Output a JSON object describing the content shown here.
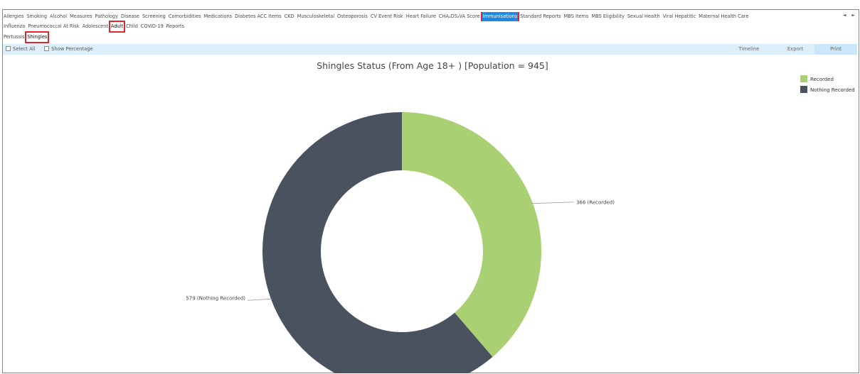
{
  "nav": {
    "main_tabs": [
      "Allergies",
      "Smoking",
      "Alcohol",
      "Measures",
      "Pathology",
      "Disease",
      "Screening",
      "Comorbidities",
      "Medications",
      "Diabetes ACC Items",
      "CKD",
      "Musculoskeletal",
      "Osteoporosis",
      "CV Event Risk",
      "Heart Failure",
      "CHA₂DS₂VA Score",
      "Immunisations",
      "Standard Reports",
      "MBS Items",
      "MBS Eligibility",
      "Sexual Health",
      "Viral Hepatitic",
      "Maternal Health Care"
    ],
    "main_selected": "Immunisations",
    "sub_tabs": [
      "Influenza",
      "Pneumococcal At Risk",
      "Adolescent",
      "Adult",
      "Child",
      "COVID-19",
      "Reports"
    ],
    "sub_selected": "Adult",
    "third_tabs": [
      "Pertussis",
      "Shingles"
    ],
    "third_selected": "Shingles",
    "scroll_arrows": "◄ ►"
  },
  "toolbar": {
    "select_all": "Select All",
    "show_percentage": "Show Percentage",
    "timeline": "Timeline",
    "export": "Export",
    "print": "Print"
  },
  "colors": {
    "accent": "#1e88e5",
    "highlight_border": "#e0262e",
    "toolbar_bg": "#ddeffb"
  },
  "chart_data": {
    "type": "pie",
    "title": "Shingles Status (From Age 18+ ) [Population = 945]",
    "donut": true,
    "legend_position": "top-right",
    "slices": [
      {
        "name": "Recorded",
        "value": 366,
        "color": "#a9d073",
        "label": "366 (Recorded)"
      },
      {
        "name": "Nothing Recorded",
        "value": 579,
        "color": "#4a5260",
        "label": "579 (Nothing Recorded)"
      }
    ]
  }
}
